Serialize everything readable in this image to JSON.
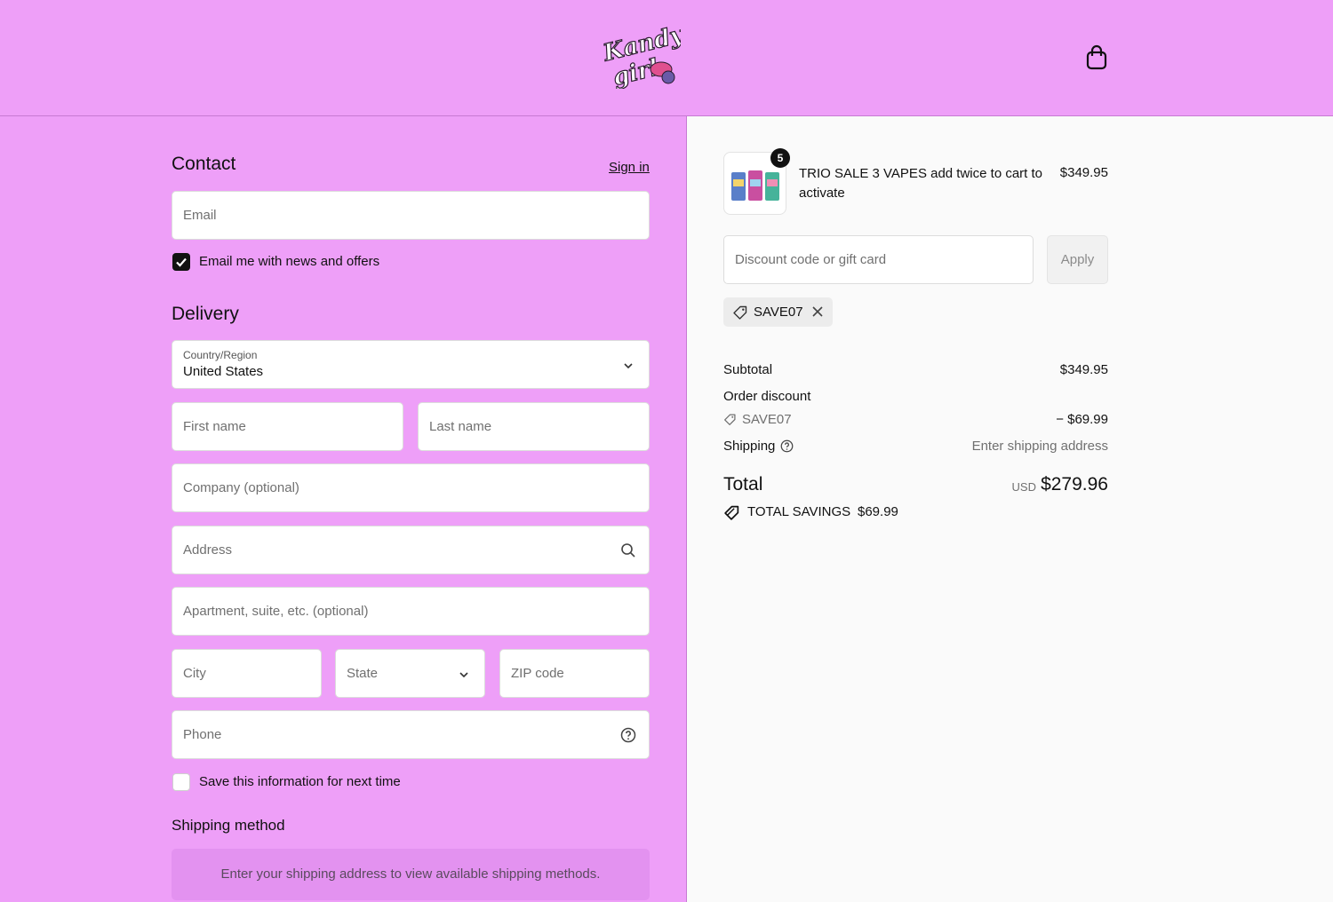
{
  "header": {
    "logo_text": "Kandy girl",
    "cart_icon": "shopping-bag-icon"
  },
  "contact": {
    "title": "Contact",
    "sign_in": "Sign in",
    "email_placeholder": "Email",
    "news_label": "Email me with news and offers",
    "news_checked": true
  },
  "delivery": {
    "title": "Delivery",
    "country_label": "Country/Region",
    "country_value": "United States",
    "first_name": "First name",
    "last_name": "Last name",
    "company": "Company (optional)",
    "address": "Address",
    "apartment": "Apartment, suite, etc. (optional)",
    "city": "City",
    "state": "State",
    "zip": "ZIP code",
    "phone": "Phone",
    "save_label": "Save this information for next time",
    "save_checked": false
  },
  "shipping_method": {
    "title": "Shipping method",
    "message": "Enter your shipping address to view available shipping methods."
  },
  "summary": {
    "item": {
      "quantity": "5",
      "name": "TRIO SALE 3 VAPES add twice to cart to activate",
      "price": "$349.95"
    },
    "discount_placeholder": "Discount code or gift card",
    "apply_label": "Apply",
    "applied_code": "SAVE07",
    "subtotal_label": "Subtotal",
    "subtotal_value": "$349.95",
    "order_discount_label": "Order discount",
    "order_discount_code": "SAVE07",
    "order_discount_value": "− $69.99",
    "shipping_label": "Shipping",
    "shipping_value": "Enter shipping address",
    "total_label": "Total",
    "total_currency": "USD",
    "total_value": "$279.96",
    "savings_label": "TOTAL SAVINGS",
    "savings_value": "$69.99"
  },
  "colors": {
    "brand_pink": "#ee9ff8",
    "shipping_box": "#e392f0"
  }
}
